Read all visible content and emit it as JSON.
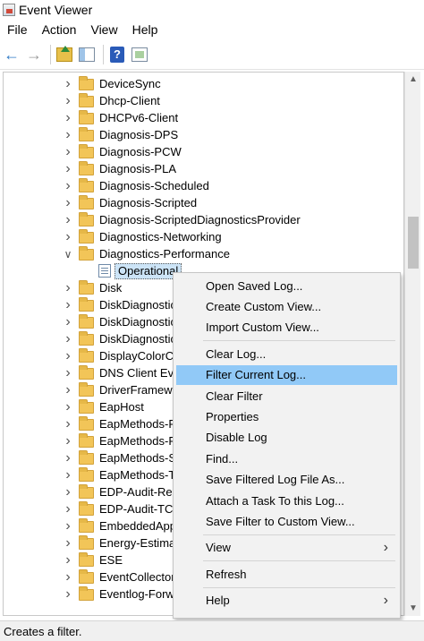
{
  "window": {
    "title": "Event Viewer"
  },
  "menu": [
    "File",
    "Action",
    "View",
    "Help"
  ],
  "toolbar": [
    "back-arrow",
    "forward-arrow",
    "up-folder",
    "show-hide-tree",
    "help",
    "show-action-pane"
  ],
  "tree": [
    {
      "label": "DeviceSync",
      "expanded": false,
      "type": "folder"
    },
    {
      "label": "Dhcp-Client",
      "expanded": false,
      "type": "folder"
    },
    {
      "label": "DHCPv6-Client",
      "expanded": false,
      "type": "folder"
    },
    {
      "label": "Diagnosis-DPS",
      "expanded": false,
      "type": "folder"
    },
    {
      "label": "Diagnosis-PCW",
      "expanded": false,
      "type": "folder"
    },
    {
      "label": "Diagnosis-PLA",
      "expanded": false,
      "type": "folder"
    },
    {
      "label": "Diagnosis-Scheduled",
      "expanded": false,
      "type": "folder"
    },
    {
      "label": "Diagnosis-Scripted",
      "expanded": false,
      "type": "folder"
    },
    {
      "label": "Diagnosis-ScriptedDiagnosticsProvider",
      "expanded": false,
      "type": "folder"
    },
    {
      "label": "Diagnostics-Networking",
      "expanded": false,
      "type": "folder"
    },
    {
      "label": "Diagnostics-Performance",
      "expanded": true,
      "type": "folder"
    },
    {
      "label": "Operational",
      "type": "log",
      "selected": true
    },
    {
      "label": "Disk",
      "expanded": false,
      "type": "folder"
    },
    {
      "label": "DiskDiagnostic",
      "expanded": false,
      "type": "folder"
    },
    {
      "label": "DiskDiagnostic",
      "expanded": false,
      "type": "folder"
    },
    {
      "label": "DiskDiagnostic",
      "expanded": false,
      "type": "folder"
    },
    {
      "label": "DisplayColorCa",
      "expanded": false,
      "type": "folder"
    },
    {
      "label": "DNS Client Eve",
      "expanded": false,
      "type": "folder"
    },
    {
      "label": "DriverFramewo",
      "expanded": false,
      "type": "folder"
    },
    {
      "label": "EapHost",
      "expanded": false,
      "type": "folder"
    },
    {
      "label": "EapMethods-R",
      "expanded": false,
      "type": "folder"
    },
    {
      "label": "EapMethods-R",
      "expanded": false,
      "type": "folder"
    },
    {
      "label": "EapMethods-S",
      "expanded": false,
      "type": "folder"
    },
    {
      "label": "EapMethods-T",
      "expanded": false,
      "type": "folder"
    },
    {
      "label": "EDP-Audit-Reg",
      "expanded": false,
      "type": "folder"
    },
    {
      "label": "EDP-Audit-TCB",
      "expanded": false,
      "type": "folder"
    },
    {
      "label": "EmbeddedApp",
      "expanded": false,
      "type": "folder"
    },
    {
      "label": "Energy-Estimat",
      "expanded": false,
      "type": "folder"
    },
    {
      "label": "ESE",
      "expanded": false,
      "type": "folder"
    },
    {
      "label": "EventCollector",
      "expanded": false,
      "type": "folder"
    },
    {
      "label": "Eventlog-Forw",
      "expanded": false,
      "type": "folder"
    }
  ],
  "context_menu": {
    "groups": [
      [
        {
          "label": "Open Saved Log..."
        },
        {
          "label": "Create Custom View..."
        },
        {
          "label": "Import Custom View..."
        }
      ],
      [
        {
          "label": "Clear Log..."
        },
        {
          "label": "Filter Current Log...",
          "highlighted": true
        },
        {
          "label": "Clear Filter"
        },
        {
          "label": "Properties"
        },
        {
          "label": "Disable Log"
        },
        {
          "label": "Find..."
        },
        {
          "label": "Save Filtered Log File As..."
        },
        {
          "label": "Attach a Task To this Log..."
        },
        {
          "label": "Save Filter to Custom View..."
        }
      ],
      [
        {
          "label": "View",
          "submenu": true
        }
      ],
      [
        {
          "label": "Refresh"
        }
      ],
      [
        {
          "label": "Help",
          "submenu": true
        }
      ]
    ]
  },
  "status": {
    "text": "Creates a filter."
  }
}
